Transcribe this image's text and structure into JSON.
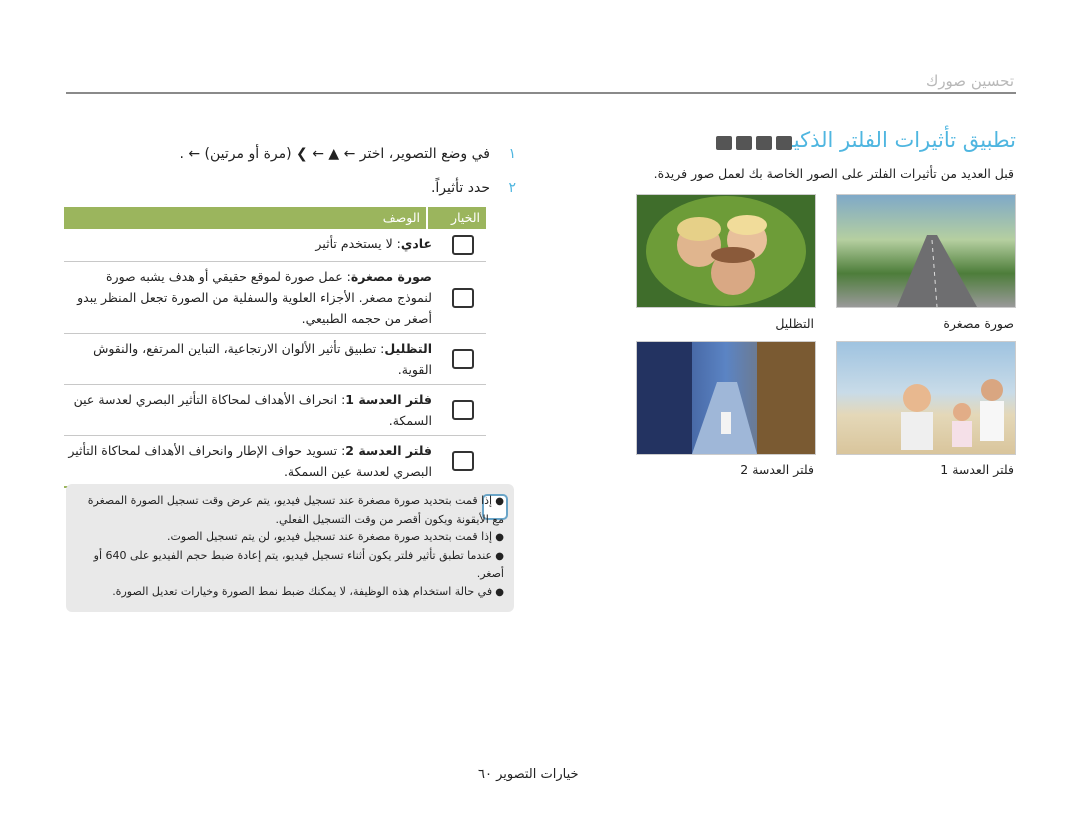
{
  "header": {
    "title": "تحسين صورك"
  },
  "section": {
    "title": "تطبيق تأثيرات الفلتر الذكية",
    "mode_icons": [
      "camera-icon",
      "smart-camera-icon",
      "dual-is-icon",
      "video-icon"
    ],
    "description": "قبل العديد من تأثيرات الفلتر على الصور الخاصة بك لعمل صور فريدة."
  },
  "photos": [
    {
      "caption": "صورة مصغرة"
    },
    {
      "caption": "التظليل"
    },
    {
      "caption": "فلتر العدسة 1"
    },
    {
      "caption": "فلتر العدسة 2"
    }
  ],
  "steps": [
    {
      "num": "١",
      "text": "في وضع التصوير، اختر ← ▲ ← ❯ (مرة أو مرتين) ← ."
    },
    {
      "num": "٢",
      "text": "حدد تأثيراً."
    }
  ],
  "table": {
    "headers": {
      "option": "الخيار",
      "description": "الوصف"
    },
    "rows": [
      {
        "icon": "filter-off-icon",
        "label": "عادي",
        "text": ": لا يستخدم تأثير"
      },
      {
        "icon": "miniature-icon",
        "label": "صورة مصغرة",
        "text": ": عمل صورة لموقع حقيقي أو هدف يشبه صورة لنموذج مصغر. الأجزاء العلوية والسفلية من الصورة تجعل المنظر يبدو أصغر من حجمه الطبيعي."
      },
      {
        "icon": "vignetting-icon",
        "label": "التظليل",
        "text": ": تطبيق تأثير الألوان الارتجاعية، التباين المرتفع، والنقوش القوية."
      },
      {
        "icon": "lens-filter-1-icon",
        "label": "فلتر العدسة 1",
        "text": ": انحراف الأهداف لمحاكاة التأثير البصري لعدسة عين السمكة."
      },
      {
        "icon": "lens-filter-2-icon",
        "label": "فلتر العدسة 2",
        "text": ": تسويد حواف الإطار وانحراف الأهداف لمحاكاة التأثير البصري لعدسة عين السمكة."
      }
    ]
  },
  "notes": [
    "إذا قمت بتحديد صورة مصغرة عند تسجيل فيديو، يتم عرض وقت تسجيل الصورة المصغرة مع الأيقونة  ويكون أقصر من وقت التسجيل الفعلي.",
    "إذا قمت بتحديد صورة مصغرة عند تسجيل فيديو، لن يتم تسجيل الصوت.",
    "عندما تطبق تأثير فلتر يكون أثناء تسجيل فيديو، يتم إعادة ضبط حجم الفيديو على 640 أو أصغر.",
    "في حالة استخدام هذه الوظيفة، لا يمكنك ضبط نمط الصورة وخيارات تعديل الصورة."
  ],
  "footer": {
    "text": "خيارات التصوير ٦٠"
  }
}
